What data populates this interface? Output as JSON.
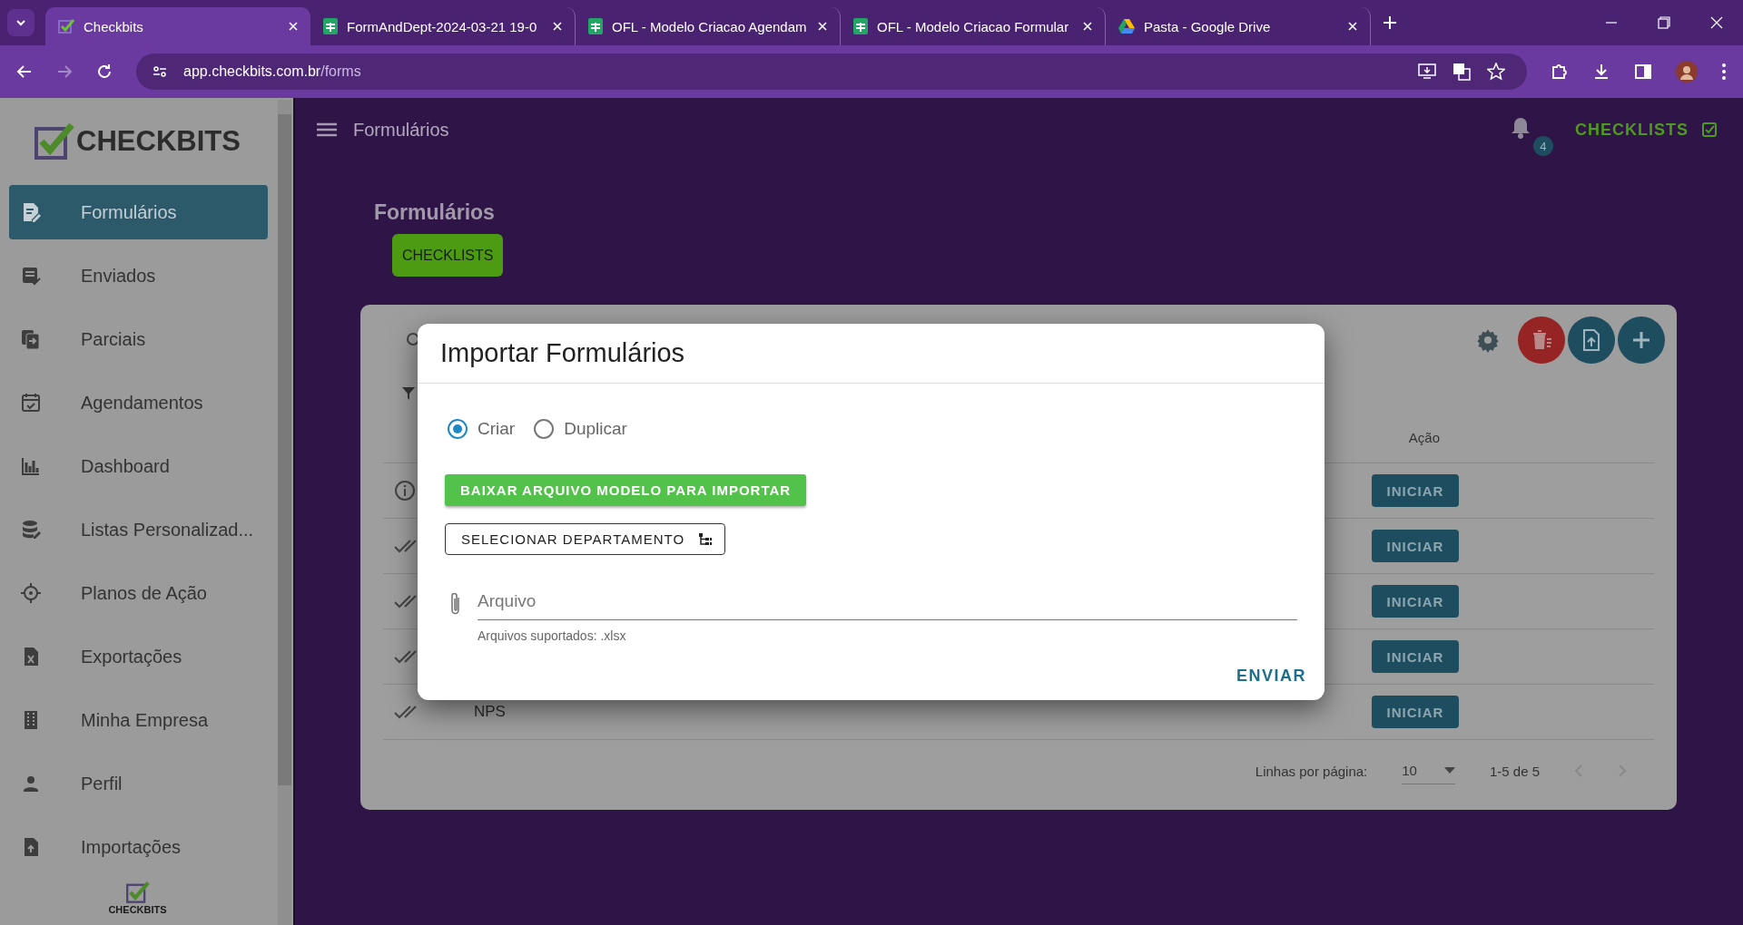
{
  "browser": {
    "tabs": [
      {
        "title": "Checkbits",
        "kind": "checkbits",
        "selected": true
      },
      {
        "title": "FormAndDept-2024-03-21 19-0",
        "kind": "sheets",
        "selected": false
      },
      {
        "title": "OFL - Modelo Criacao Agendam",
        "kind": "sheets",
        "selected": false
      },
      {
        "title": "OFL - Modelo Criacao Formular",
        "kind": "sheets",
        "selected": false
      },
      {
        "title": "Pasta - Google Drive",
        "kind": "drive",
        "selected": false
      }
    ],
    "url_host": "app.checkbits.com.br",
    "url_path": "/forms"
  },
  "sidebar": {
    "logo": "CHECKBITS",
    "items": [
      {
        "label": "Formulários",
        "kind": "form",
        "selected": true
      },
      {
        "label": "Enviados",
        "kind": "sent",
        "selected": false
      },
      {
        "label": "Parciais",
        "kind": "partial",
        "selected": false
      },
      {
        "label": "Agendamentos",
        "kind": "calendar",
        "selected": false
      },
      {
        "label": "Dashboard",
        "kind": "chart",
        "selected": false
      },
      {
        "label": "Listas Personalizad...",
        "kind": "database",
        "selected": false
      },
      {
        "label": "Planos de Ação",
        "kind": "target",
        "selected": false
      },
      {
        "label": "Exportações",
        "kind": "excel",
        "selected": false
      },
      {
        "label": "Minha Empresa",
        "kind": "building",
        "selected": false
      },
      {
        "label": "Perfil",
        "kind": "person",
        "selected": false
      },
      {
        "label": "Importações",
        "kind": "upload",
        "selected": false
      }
    ],
    "footer_logo": "CHECKBITS"
  },
  "header": {
    "title": "Formulários",
    "notifications": "4",
    "link": "CHECKLISTS"
  },
  "page": {
    "title": "Formulários",
    "chip": "CHECKLISTS"
  },
  "table": {
    "action_header": "Ação",
    "rows": [
      {
        "kind": "info",
        "action": "INICIAR"
      },
      {
        "kind": "done",
        "action": "INICIAR"
      },
      {
        "kind": "done",
        "action": "INICIAR"
      },
      {
        "kind": "done",
        "action": "INICIAR"
      },
      {
        "kind": "done",
        "name": "NPS",
        "action": "INICIAR"
      }
    ],
    "rows_per_page_label": "Linhas por página:",
    "rows_per_page": "10",
    "range": "1-5 de 5"
  },
  "dialog": {
    "title": "Importar Formulários",
    "options": [
      {
        "label": "Criar",
        "selected": true
      },
      {
        "label": "Duplicar",
        "selected": false
      }
    ],
    "download_button": "BAIXAR ARQUIVO MODELO PARA IMPORTAR",
    "department_button": "SELECIONAR DEPARTAMENTO",
    "file_placeholder": "Arquivo",
    "file_hint": "Arquivos suportados: .xlsx",
    "submit": "ENVIAR"
  }
}
